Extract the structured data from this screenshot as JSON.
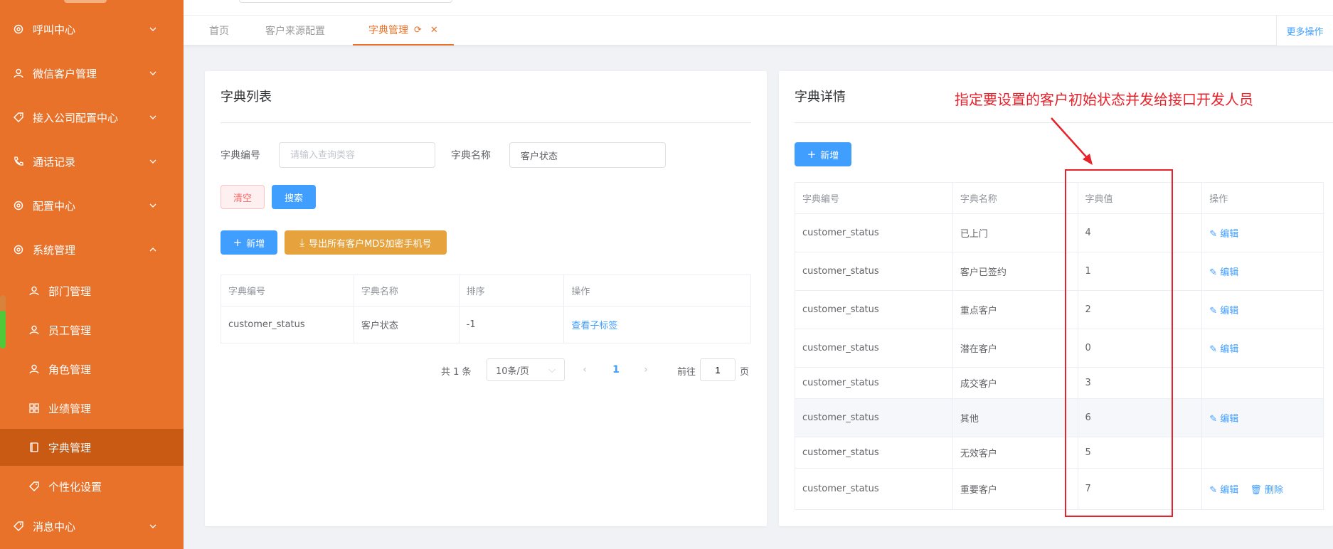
{
  "sidebar": {
    "menus": [
      {
        "label": "呼叫中心",
        "icon": "gear-icon"
      },
      {
        "label": "微信客户管理",
        "icon": "user-icon"
      },
      {
        "label": "接入公司配置中心",
        "icon": "tag-icon"
      },
      {
        "label": "通话记录",
        "icon": "phone-icon"
      },
      {
        "label": "配置中心",
        "icon": "gear-icon"
      },
      {
        "label": "系统管理",
        "icon": "gear-icon"
      }
    ],
    "sub_items": [
      {
        "label": "部门管理",
        "icon": "user-icon"
      },
      {
        "label": "员工管理",
        "icon": "user-icon"
      },
      {
        "label": "角色管理",
        "icon": "user-icon"
      },
      {
        "label": "业绩管理",
        "icon": "grid-icon"
      },
      {
        "label": "字典管理",
        "icon": "book-icon"
      },
      {
        "label": "个性化设置",
        "icon": "tag-icon"
      }
    ],
    "bottom_menu": {
      "label": "消息中心",
      "icon": "tag-icon"
    }
  },
  "tabs": {
    "home": "首页",
    "source": "客户来源配置",
    "active": "字典管理",
    "more": "更多操作"
  },
  "left_card": {
    "title": "字典列表",
    "code_label": "字典编号",
    "code_placeholder": "请输入查询类容",
    "name_label": "字典名称",
    "name_value": "客户状态",
    "clear_btn": "清空",
    "search_btn": "搜索",
    "add_btn": "新增",
    "export_btn": "导出所有客户MD5加密手机号",
    "table": {
      "headers": [
        "字典编号",
        "字典名称",
        "排序",
        "操作"
      ],
      "rows": [
        {
          "code": "customer_status",
          "name": "客户状态",
          "sort": "-1",
          "op": "查看子标签"
        }
      ]
    },
    "pager": {
      "total": "共 1 条",
      "size": "10条/页",
      "page": "1",
      "goto": "前往",
      "goto_value": "1",
      "page_suffix": "页"
    }
  },
  "right_card": {
    "title": "字典详情",
    "add_btn": "新增",
    "annotation": "指定要设置的客户初始状态并发给接口开发人员",
    "table": {
      "headers": [
        "字典编号",
        "字典名称",
        "字典值",
        "操作"
      ],
      "rows": [
        {
          "code": "customer_status",
          "name": "已上门",
          "value": "4",
          "edit": "编辑",
          "delete": ""
        },
        {
          "code": "customer_status",
          "name": "客户已签约",
          "value": "1",
          "edit": "编辑",
          "delete": ""
        },
        {
          "code": "customer_status",
          "name": "重点客户",
          "value": "2",
          "edit": "编辑",
          "delete": ""
        },
        {
          "code": "customer_status",
          "name": "潜在客户",
          "value": "0",
          "edit": "编辑",
          "delete": ""
        },
        {
          "code": "customer_status",
          "name": "成交客户",
          "value": "3",
          "edit": "",
          "delete": ""
        },
        {
          "code": "customer_status",
          "name": "其他",
          "value": "6",
          "edit": "编辑",
          "delete": ""
        },
        {
          "code": "customer_status",
          "name": "无效客户",
          "value": "5",
          "edit": "",
          "delete": ""
        },
        {
          "code": "customer_status",
          "name": "重要客户",
          "value": "7",
          "edit": "编辑",
          "delete": "删除"
        }
      ]
    }
  },
  "colors": {
    "sidebar_bg": "#e8722a",
    "sidebar_active": "#c85a14",
    "primary": "#409eff",
    "warning": "#e6a23c",
    "annotation": "#e8212a"
  }
}
